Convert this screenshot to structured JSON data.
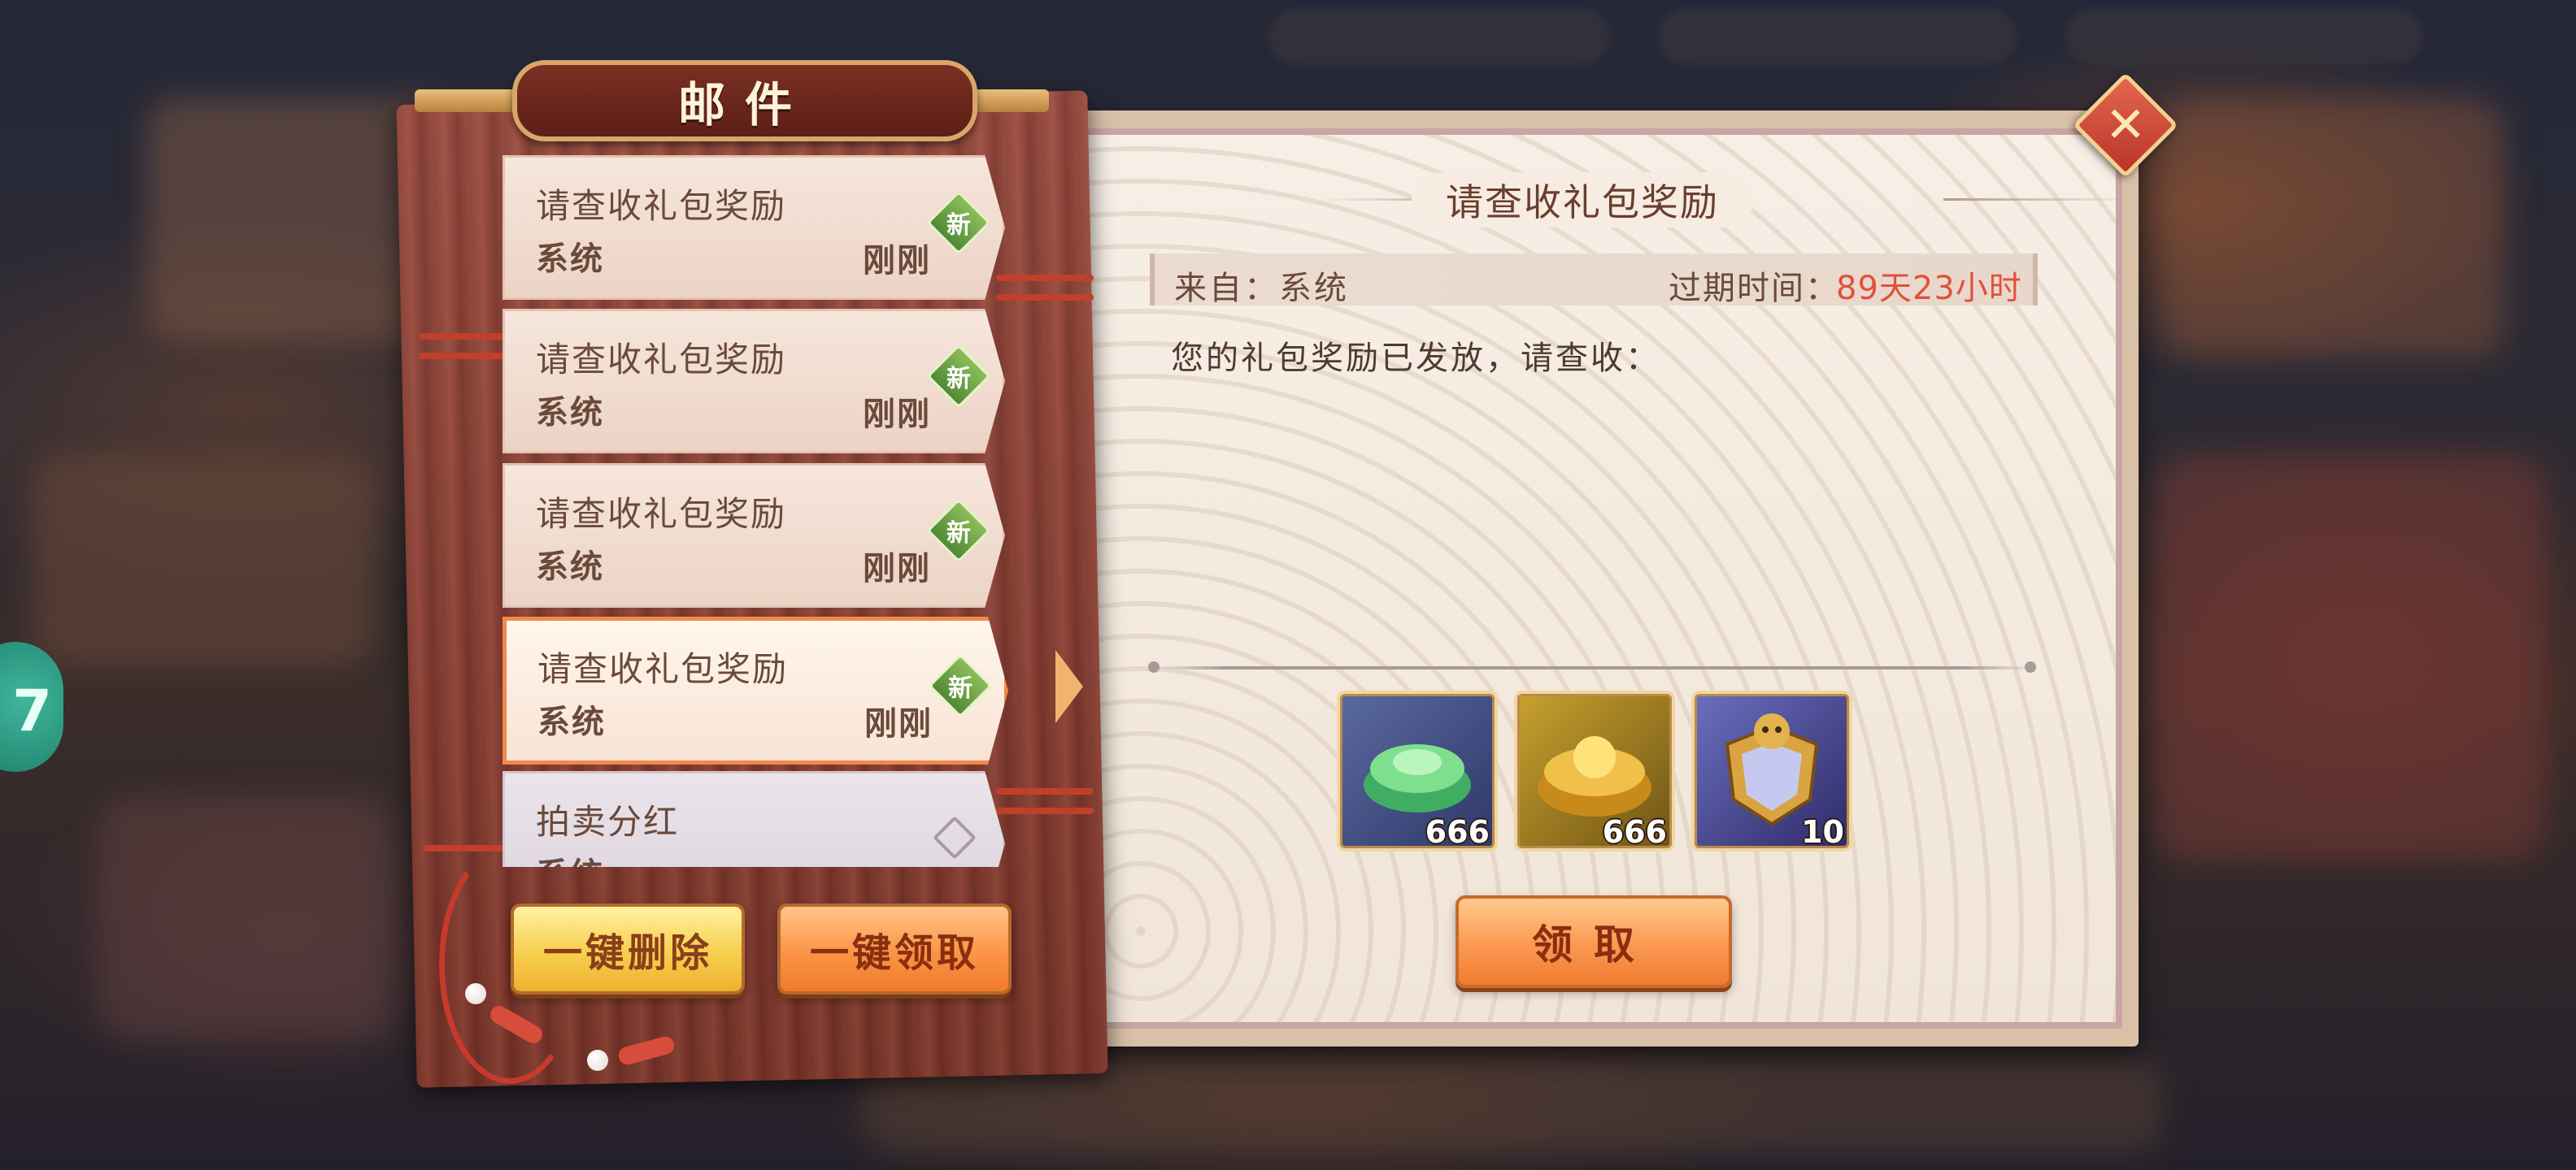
{
  "panel": {
    "title": "邮件"
  },
  "mail_list": [
    {
      "title": "请查收礼包奖励",
      "sender": "系统",
      "time": "刚刚",
      "badge": "新",
      "state": "unread"
    },
    {
      "title": "请查收礼包奖励",
      "sender": "系统",
      "time": "刚刚",
      "badge": "新",
      "state": "unread"
    },
    {
      "title": "请查收礼包奖励",
      "sender": "系统",
      "time": "刚刚",
      "badge": "新",
      "state": "unread"
    },
    {
      "title": "请查收礼包奖励",
      "sender": "系统",
      "time": "刚刚",
      "badge": "新",
      "state": "selected"
    },
    {
      "title": "拍卖分红",
      "sender": "系统",
      "time": "",
      "badge": "",
      "state": "read"
    }
  ],
  "actions": {
    "delete_all": "一键删除",
    "claim_all": "一键领取"
  },
  "detail": {
    "title": "请查收礼包奖励",
    "from": "来自：系统",
    "expire_label": "过期时间：",
    "expire_value": "89天23小时",
    "body": "您的礼包奖励已发放，请查收：",
    "rewards": [
      {
        "icon": "jade-ingot-icon",
        "count": "666"
      },
      {
        "icon": "gold-ingot-icon",
        "count": "666"
      },
      {
        "icon": "divine-shield-icon",
        "count": "10"
      }
    ],
    "claim_label": "领取"
  },
  "close": {
    "label": "✕"
  },
  "side_float": {
    "label": "7"
  },
  "colors": {
    "accent_orange": "#f07b2e",
    "new_badge_green": "#4f8a34",
    "expire_red": "#e0523a"
  }
}
